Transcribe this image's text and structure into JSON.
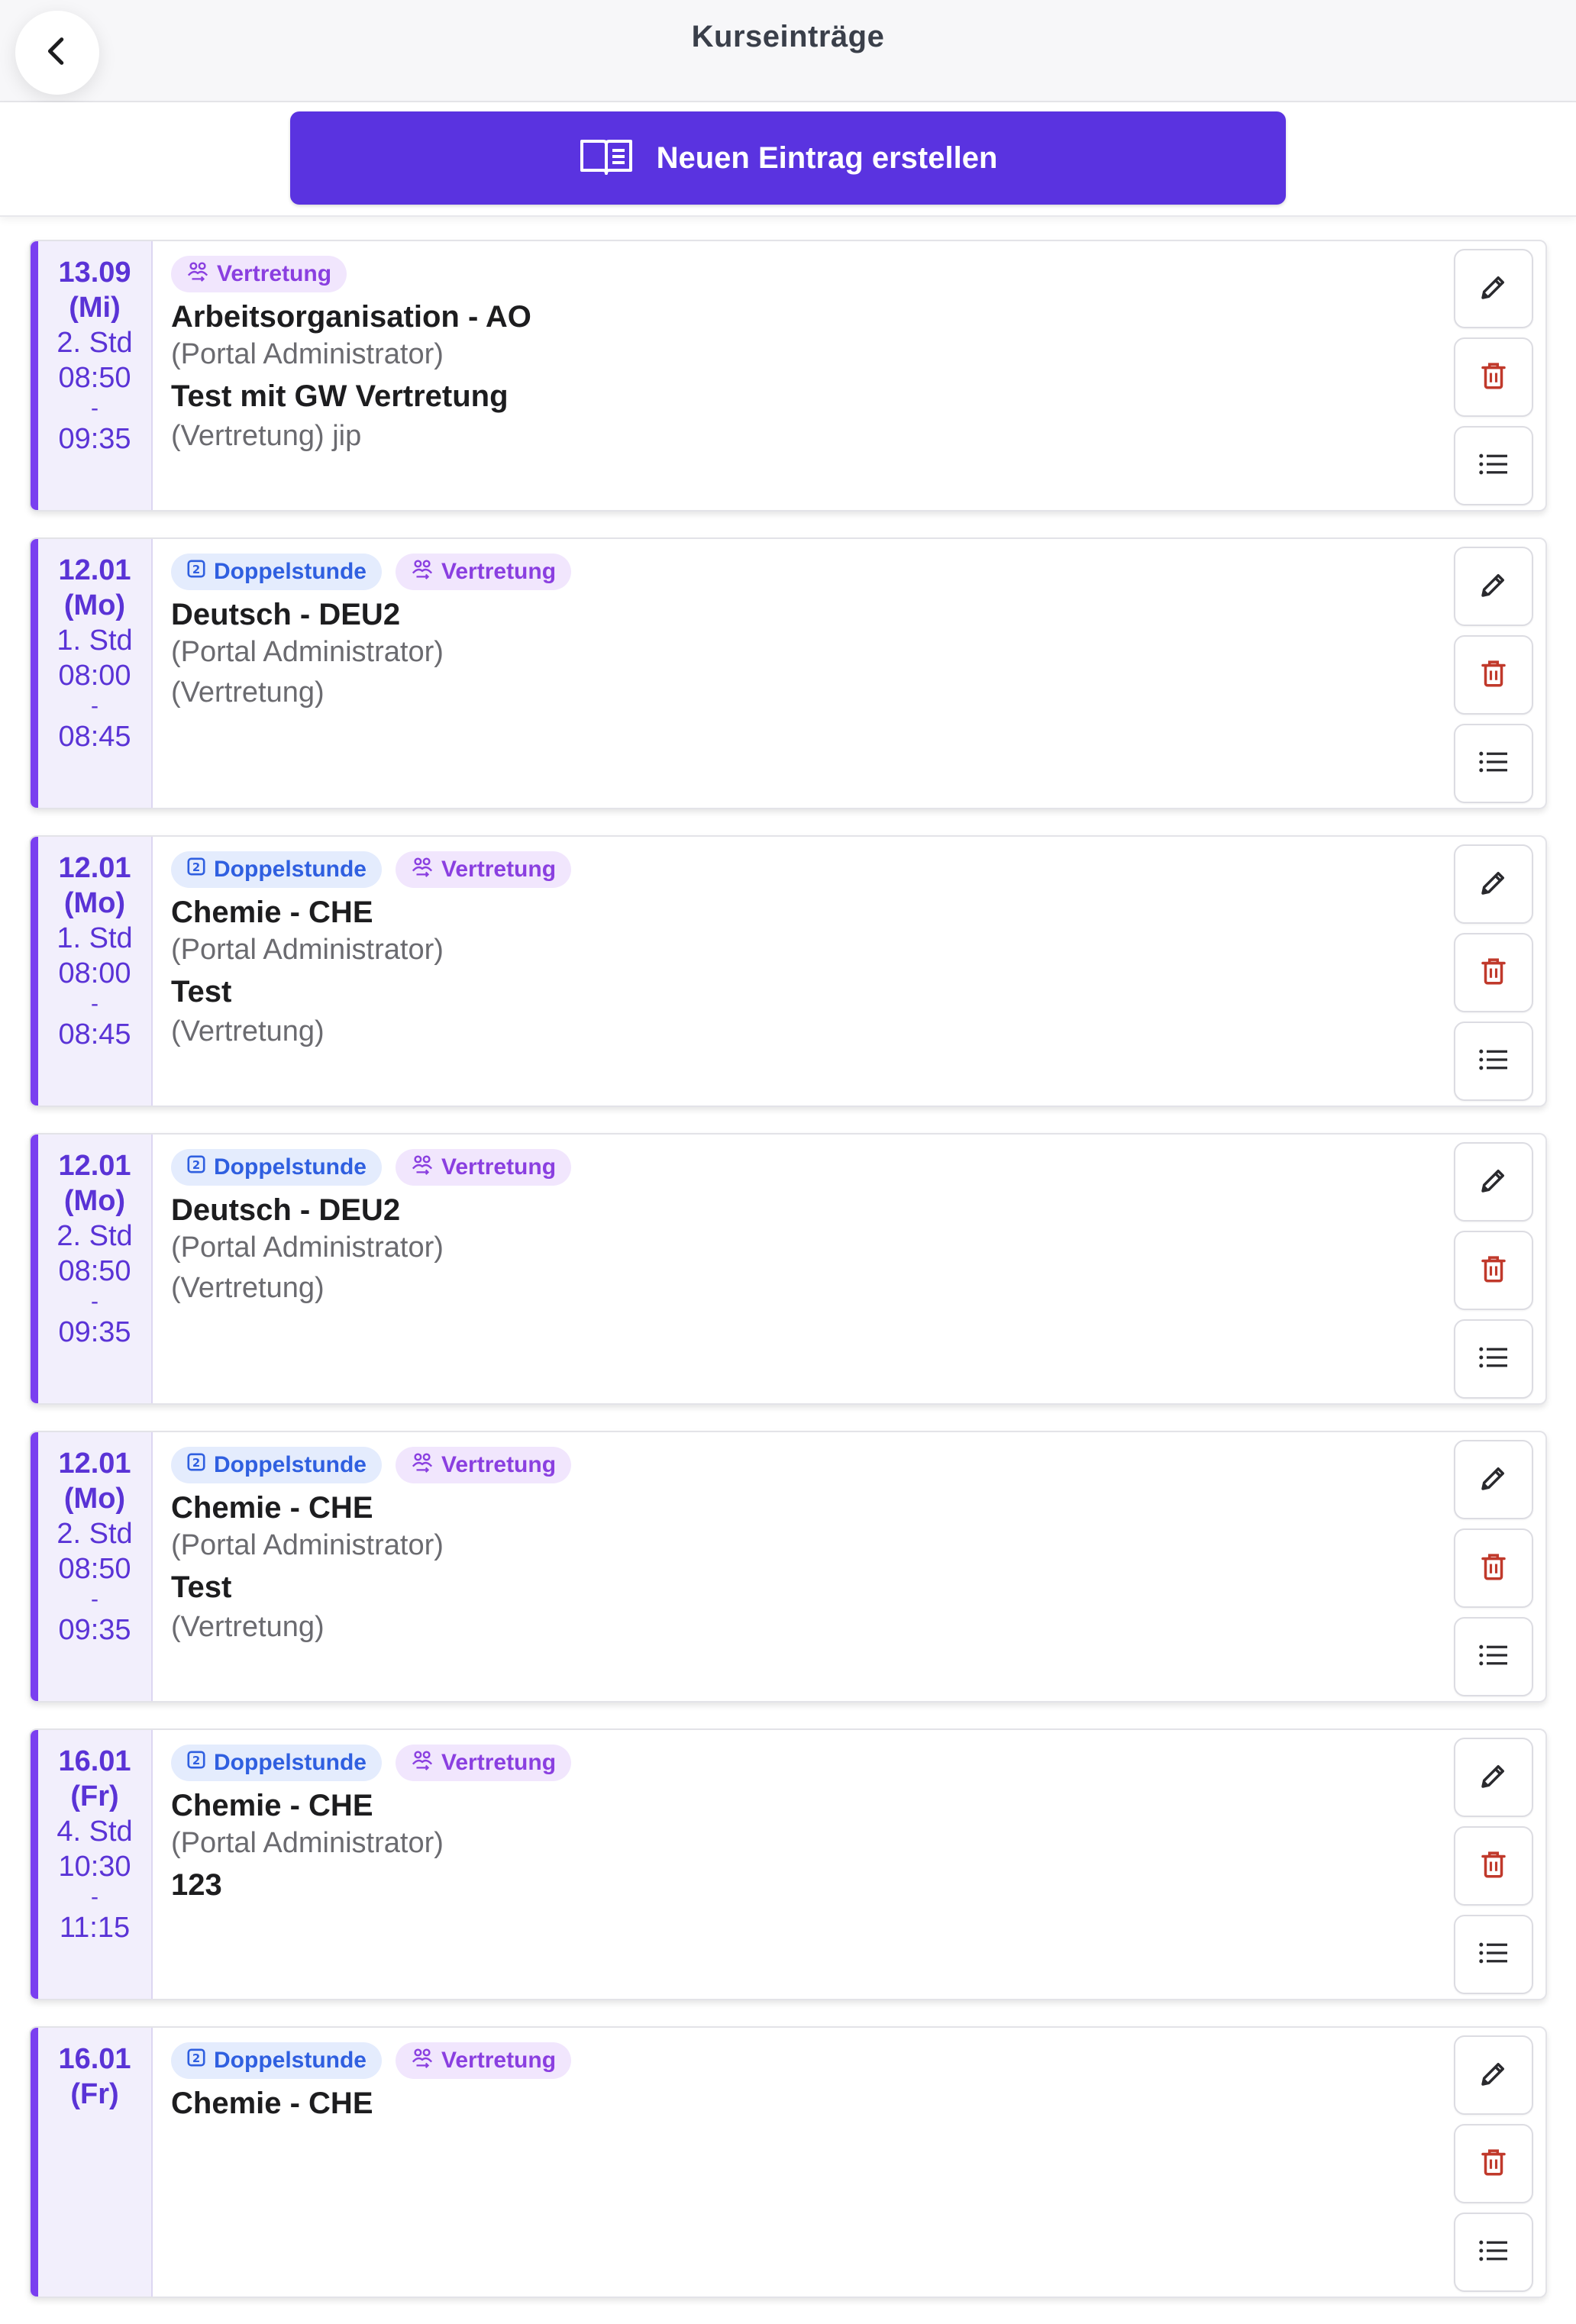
{
  "header": {
    "title": "Kurseinträge"
  },
  "toolbar": {
    "new_entry_label": "Neuen Eintrag erstellen"
  },
  "entries": [
    {
      "date": "13.09",
      "day": "(Mi)",
      "period": "2. Std",
      "start": "08:50",
      "dash": "-",
      "end": "09:35",
      "badges": [
        "Vertretung"
      ],
      "course": "Arbeitsorganisation - AO",
      "teacher": "(Portal Administrator)",
      "topic": "Test mit GW Vertretung",
      "note": "(Vertretung) jip"
    },
    {
      "date": "12.01",
      "day": "(Mo)",
      "period": "1. Std",
      "start": "08:00",
      "dash": "-",
      "end": "08:45",
      "badges": [
        "Doppelstunde",
        "Vertretung"
      ],
      "course": "Deutsch - DEU2",
      "teacher": "(Portal Administrator)",
      "topic": "",
      "note": "(Vertretung)"
    },
    {
      "date": "12.01",
      "day": "(Mo)",
      "period": "1. Std",
      "start": "08:00",
      "dash": "-",
      "end": "08:45",
      "badges": [
        "Doppelstunde",
        "Vertretung"
      ],
      "course": "Chemie - CHE",
      "teacher": "(Portal Administrator)",
      "topic": "Test",
      "note": "(Vertretung)"
    },
    {
      "date": "12.01",
      "day": "(Mo)",
      "period": "2. Std",
      "start": "08:50",
      "dash": "-",
      "end": "09:35",
      "badges": [
        "Doppelstunde",
        "Vertretung"
      ],
      "course": "Deutsch - DEU2",
      "teacher": "(Portal Administrator)",
      "topic": "",
      "note": "(Vertretung)"
    },
    {
      "date": "12.01",
      "day": "(Mo)",
      "period": "2. Std",
      "start": "08:50",
      "dash": "-",
      "end": "09:35",
      "badges": [
        "Doppelstunde",
        "Vertretung"
      ],
      "course": "Chemie - CHE",
      "teacher": "(Portal Administrator)",
      "topic": "Test",
      "note": "(Vertretung)"
    },
    {
      "date": "16.01",
      "day": "(Fr)",
      "period": "4. Std",
      "start": "10:30",
      "dash": "-",
      "end": "11:15",
      "badges": [
        "Doppelstunde",
        "Vertretung"
      ],
      "course": "Chemie - CHE",
      "teacher": "(Portal Administrator)",
      "topic": "123",
      "note": ""
    },
    {
      "date": "16.01",
      "day": "(Fr)",
      "period": "",
      "start": "",
      "dash": "",
      "end": "",
      "badges": [
        "Doppelstunde",
        "Vertretung"
      ],
      "course": "Chemie - CHE",
      "teacher": "",
      "topic": "",
      "note": ""
    }
  ],
  "colors": {
    "accent": "#5a33e0",
    "time_border": "#7a3ff0",
    "delete": "#c0392b"
  }
}
